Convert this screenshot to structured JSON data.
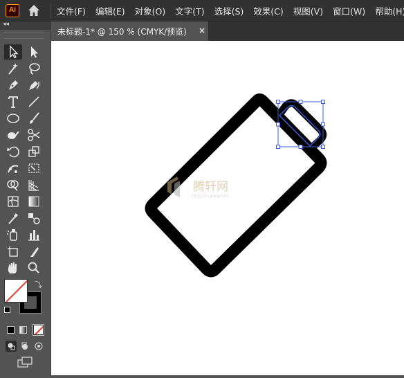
{
  "app": {
    "logo_text": "Ai"
  },
  "menu": {
    "items": [
      "文件(F)",
      "编辑(E)",
      "对象(O)",
      "文字(T)",
      "选择(S)",
      "效果(C)",
      "视图(V)",
      "窗口(W)",
      "帮助(H)"
    ]
  },
  "document_tab": {
    "title": "未标题-1* @ 150 % (CMYK/预览)",
    "close_glyph": "×"
  },
  "toolbar": {
    "tools": [
      "selection-tool",
      "direct-selection-tool",
      "magic-wand-tool",
      "lasso-tool",
      "pen-tool",
      "curvature-tool",
      "type-tool",
      "line-segment-tool",
      "ellipse-tool",
      "paintbrush-tool",
      "shaper-tool",
      "scissors-tool",
      "rotate-tool",
      "scale-tool",
      "puppet-warp-tool",
      "free-transform-tool",
      "shape-builder-tool",
      "perspective-grid-tool",
      "mesh-tool",
      "gradient-tool",
      "eyedropper-tool",
      "blend-tool",
      "symbol-sprayer-tool",
      "column-graph-tool",
      "artboard-tool",
      "slice-tool",
      "hand-tool",
      "zoom-tool"
    ],
    "fill_color": "#ffffff",
    "stroke_color": "#000000"
  },
  "watermark": {
    "text": "腾轩网",
    "subtext": "TENGXUANWANG"
  },
  "colors": {
    "accent": "#ff9a00",
    "selection": "#3b5bdb",
    "canvas": "#ffffff"
  }
}
